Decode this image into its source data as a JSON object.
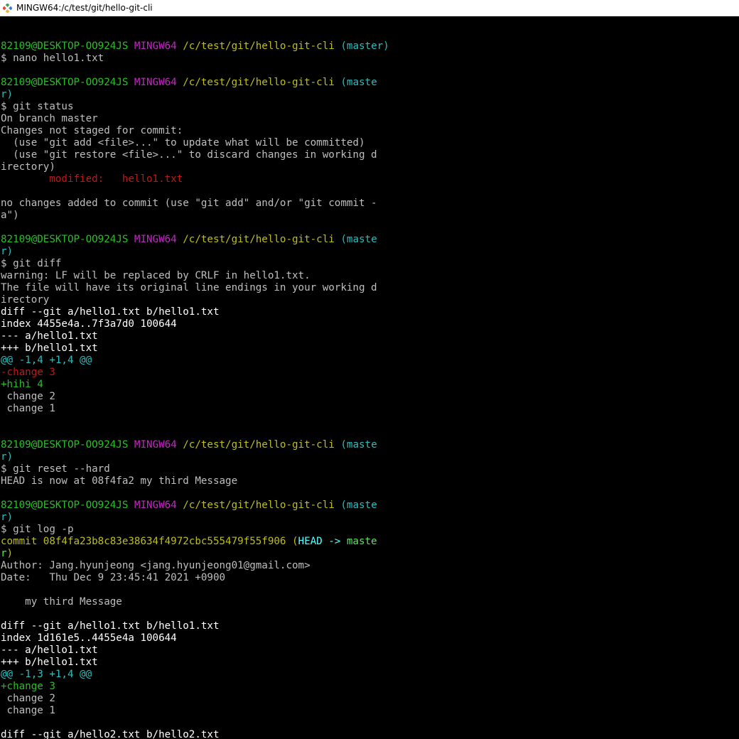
{
  "window": {
    "title": "MINGW64:/c/test/git/hello-git-cli"
  },
  "colors": {
    "fg": "#bfbfbf",
    "green": "#26c026",
    "magenta": "#c327c3",
    "yellow": "#bfbf18",
    "cyan": "#27bfbf",
    "red": "#c01818",
    "bright_cyan": "#55ffff",
    "bright_green": "#55e85a",
    "white": "#ffffff"
  },
  "terminal": {
    "lines": [
      [
        [
          "fg",
          ""
        ]
      ],
      [
        [
          "green",
          "82109@DESKTOP-OO924JS "
        ],
        [
          "magenta",
          "MINGW64 "
        ],
        [
          "yellow",
          "/c/test/git/hello-git-cli "
        ],
        [
          "cyan",
          "(master)"
        ]
      ],
      [
        [
          "fg",
          "$ nano hello1.txt"
        ]
      ],
      [
        [
          "fg",
          ""
        ]
      ],
      [
        [
          "green",
          "82109@DESKTOP-OO924JS "
        ],
        [
          "magenta",
          "MINGW64 "
        ],
        [
          "yellow",
          "/c/test/git/hello-git-cli "
        ],
        [
          "cyan",
          "(maste"
        ]
      ],
      [
        [
          "cyan",
          "r)"
        ]
      ],
      [
        [
          "fg",
          "$ git status"
        ]
      ],
      [
        [
          "fg",
          "On branch master"
        ]
      ],
      [
        [
          "fg",
          "Changes not staged for commit:"
        ]
      ],
      [
        [
          "fg",
          "  (use \"git add <file>...\" to update what will be committed)"
        ]
      ],
      [
        [
          "fg",
          "  (use \"git restore <file>...\" to discard changes in working d"
        ]
      ],
      [
        [
          "fg",
          "irectory)"
        ]
      ],
      [
        [
          "red",
          "        modified:   hello1.txt"
        ]
      ],
      [
        [
          "fg",
          ""
        ]
      ],
      [
        [
          "fg",
          "no changes added to commit (use \"git add\" and/or \"git commit -"
        ]
      ],
      [
        [
          "fg",
          "a\")"
        ]
      ],
      [
        [
          "fg",
          ""
        ]
      ],
      [
        [
          "green",
          "82109@DESKTOP-OO924JS "
        ],
        [
          "magenta",
          "MINGW64 "
        ],
        [
          "yellow",
          "/c/test/git/hello-git-cli "
        ],
        [
          "cyan",
          "(maste"
        ]
      ],
      [
        [
          "cyan",
          "r)"
        ]
      ],
      [
        [
          "fg",
          "$ git diff"
        ]
      ],
      [
        [
          "fg",
          "warning: LF will be replaced by CRLF in hello1.txt."
        ]
      ],
      [
        [
          "fg",
          "The file will have its original line endings in your working d"
        ]
      ],
      [
        [
          "fg",
          "irectory"
        ]
      ],
      [
        [
          "white",
          "diff --git a/hello1.txt b/hello1.txt"
        ]
      ],
      [
        [
          "white",
          "index 4455e4a..7f3a7d0 100644"
        ]
      ],
      [
        [
          "white",
          "--- a/hello1.txt"
        ]
      ],
      [
        [
          "white",
          "+++ b/hello1.txt"
        ]
      ],
      [
        [
          "cyan",
          "@@ -1,4 +1,4 @@"
        ]
      ],
      [
        [
          "red",
          "-change 3"
        ]
      ],
      [
        [
          "green",
          "+hihi 4"
        ]
      ],
      [
        [
          "fg",
          " change 2"
        ]
      ],
      [
        [
          "fg",
          " change 1"
        ]
      ],
      [
        [
          "fg",
          ""
        ]
      ],
      [
        [
          "fg",
          ""
        ]
      ],
      [
        [
          "green",
          "82109@DESKTOP-OO924JS "
        ],
        [
          "magenta",
          "MINGW64 "
        ],
        [
          "yellow",
          "/c/test/git/hello-git-cli "
        ],
        [
          "cyan",
          "(maste"
        ]
      ],
      [
        [
          "cyan",
          "r)"
        ]
      ],
      [
        [
          "fg",
          "$ git reset --hard"
        ]
      ],
      [
        [
          "fg",
          "HEAD is now at 08f4fa2 my third Message"
        ]
      ],
      [
        [
          "fg",
          ""
        ]
      ],
      [
        [
          "green",
          "82109@DESKTOP-OO924JS "
        ],
        [
          "magenta",
          "MINGW64 "
        ],
        [
          "yellow",
          "/c/test/git/hello-git-cli "
        ],
        [
          "cyan",
          "(maste"
        ]
      ],
      [
        [
          "cyan",
          "r)"
        ]
      ],
      [
        [
          "fg",
          "$ git log -p"
        ]
      ],
      [
        [
          "yellow",
          "commit 08f4fa23b8c83e38634f4972cbc555479f55f906 ("
        ],
        [
          "bright_cyan",
          "HEAD -> "
        ],
        [
          "bright_green",
          "maste"
        ]
      ],
      [
        [
          "bright_green",
          "r"
        ],
        [
          "yellow",
          ")"
        ]
      ],
      [
        [
          "fg",
          "Author: Jang.hyunjeong <jang.hyunjeong01@gmail.com>"
        ]
      ],
      [
        [
          "fg",
          "Date:   Thu Dec 9 23:45:41 2021 +0900"
        ]
      ],
      [
        [
          "fg",
          ""
        ]
      ],
      [
        [
          "fg",
          "    my third Message"
        ]
      ],
      [
        [
          "fg",
          ""
        ]
      ],
      [
        [
          "white",
          "diff --git a/hello1.txt b/hello1.txt"
        ]
      ],
      [
        [
          "white",
          "index 1d161e5..4455e4a 100644"
        ]
      ],
      [
        [
          "white",
          "--- a/hello1.txt"
        ]
      ],
      [
        [
          "white",
          "+++ b/hello1.txt"
        ]
      ],
      [
        [
          "cyan",
          "@@ -1,3 +1,4 @@"
        ]
      ],
      [
        [
          "green",
          "+change 3"
        ]
      ],
      [
        [
          "fg",
          " change 2"
        ]
      ],
      [
        [
          "fg",
          " change 1"
        ]
      ],
      [
        [
          "fg",
          ""
        ]
      ],
      [
        [
          "white",
          "diff --git a/hello2.txt b/hello2.txt"
        ]
      ]
    ]
  }
}
